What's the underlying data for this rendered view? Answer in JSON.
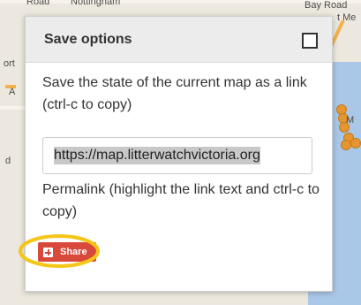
{
  "map": {
    "labels": [
      "Road",
      "Nottingham",
      "Bay Road",
      "t Me",
      "ort",
      "A",
      "M",
      "d"
    ]
  },
  "dialog": {
    "title": "Save options",
    "close_icon": "checkbox-close-icon",
    "description": "Save the state of the current map as a link (ctrl-c to copy)",
    "permalink_value": "https://map.litterwatchvictoria.org",
    "hint": "Permalink (highlight the link text and ctrl-c to copy)",
    "share_label": "Share",
    "share_icon": "google-plus-icon",
    "colors": {
      "share_button": "#d8493c",
      "highlight_ring": "#f5c518",
      "header": "#ececec"
    }
  }
}
